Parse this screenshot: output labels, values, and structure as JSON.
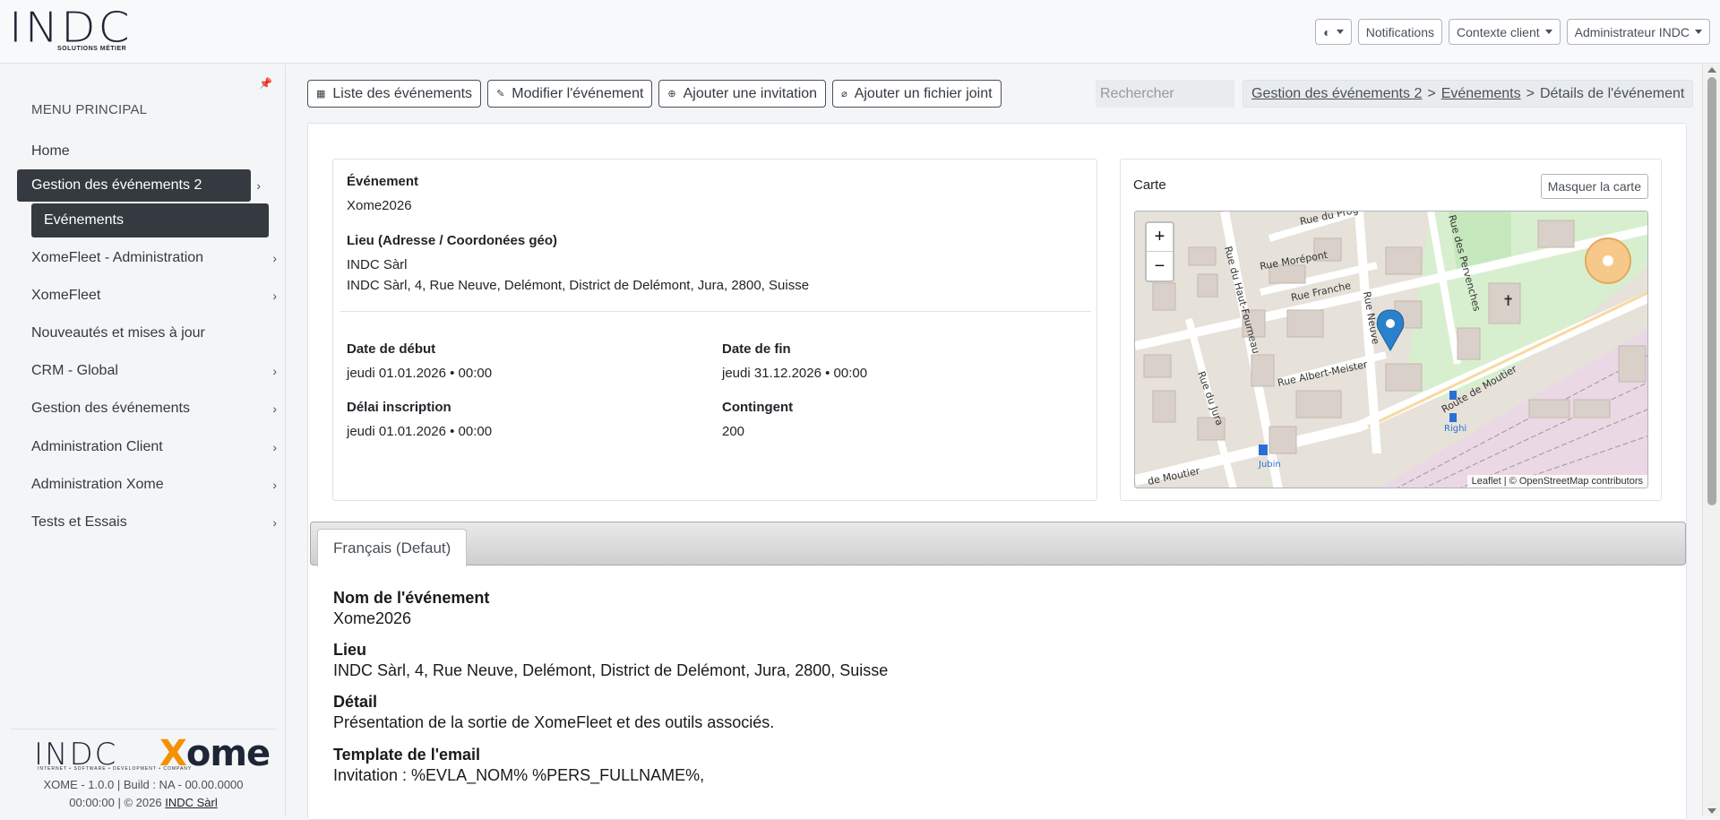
{
  "brand": {
    "logo_text": "INDC",
    "logo_sub": "SOLUTIONS MÉTIER"
  },
  "topbar": {
    "theme_icon": "◐",
    "notifications": "Notifications",
    "client_context": "Contexte client",
    "user": "Administrateur INDC"
  },
  "sidebar": {
    "title": "MENU PRINCIPAL",
    "items": [
      {
        "label": "Home"
      },
      {
        "label": "Gestion des événements 2"
      },
      {
        "label": "XomeFleet - Administration"
      },
      {
        "label": "XomeFleet"
      },
      {
        "label": "Nouveautés et mises à jour"
      },
      {
        "label": "CRM - Global"
      },
      {
        "label": "Gestion des événements"
      },
      {
        "label": "Administration Client"
      },
      {
        "label": "Administration Xome"
      },
      {
        "label": "Tests et Essais"
      }
    ],
    "sub_active": "Evénements",
    "footer": {
      "indc": "INDC",
      "xome_x": "X",
      "xome_rest": "ome",
      "tagline": "INTERNET • SOFTWARE • DEVELOPMENT • COMPANY",
      "version_line1": "XOME - 1.0.0 | Build : NA - 00.00.0000",
      "version_line2": "00:00:00 | © 2026",
      "company_link": "INDC Sàrl"
    }
  },
  "actions": {
    "list": "Liste des événements",
    "edit": "Modifier l'événement",
    "add_invite": "Ajouter une invitation",
    "add_file": "Ajouter un fichier joint"
  },
  "search": {
    "placeholder": "Rechercher"
  },
  "breadcrumb": {
    "crumb1": "Gestion des événements 2",
    "crumb2": "Evénements",
    "current": "Détails de l'événement",
    "sep": ">"
  },
  "event": {
    "event_label": "Événement",
    "event_value": "Xome2026",
    "place_label": "Lieu (Adresse / Coordonées géo)",
    "place_name": "INDC Sàrl",
    "place_address": "INDC Sàrl, 4, Rue Neuve, Delémont, District de Delémont, Jura, 2800, Suisse",
    "start_label": "Date de début",
    "start_value": "jeudi 01.01.2026 • 00:00",
    "end_label": "Date de fin",
    "end_value": "jeudi 31.12.2026 • 00:00",
    "deadline_label": "Délai inscription",
    "deadline_value": "jeudi 01.01.2026 • 00:00",
    "quota_label": "Contingent",
    "quota_value": "200"
  },
  "map": {
    "title": "Carte",
    "hide_button": "Masquer la carte",
    "zoom_in": "+",
    "zoom_out": "−",
    "attribution": "Leaflet | © OpenStreetMap contributors",
    "streets": [
      "Rue du Haut-Fourneau",
      "Rue Morépont",
      "Rue Franche",
      "Rue Neuve",
      "Rue Albert-Meister",
      "Rue du Jura",
      "Route de Moutier",
      "Rue des Pervenches",
      "Rue du Prog",
      "de Moutier"
    ],
    "labels": [
      "Jubin",
      "Righi"
    ]
  },
  "tabs": {
    "active": "Français (Defaut)"
  },
  "details": {
    "name_label": "Nom de l'événement",
    "name_value": "Xome2026",
    "place_label": "Lieu",
    "place_value": "INDC Sàrl, 4, Rue Neuve, Delémont, District de Delémont, Jura, 2800, Suisse",
    "detail_label": "Détail",
    "detail_value": "Présentation de la sortie de XomeFleet et des outils associés.",
    "template_label": "Template de l'email",
    "template_value": "Invitation : %EVLA_NOM% %PERS_FULLNAME%,"
  },
  "colors": {
    "sidebar_active": "#343a40",
    "accent_orange": "#f39200",
    "marker": "#2a81cb"
  }
}
